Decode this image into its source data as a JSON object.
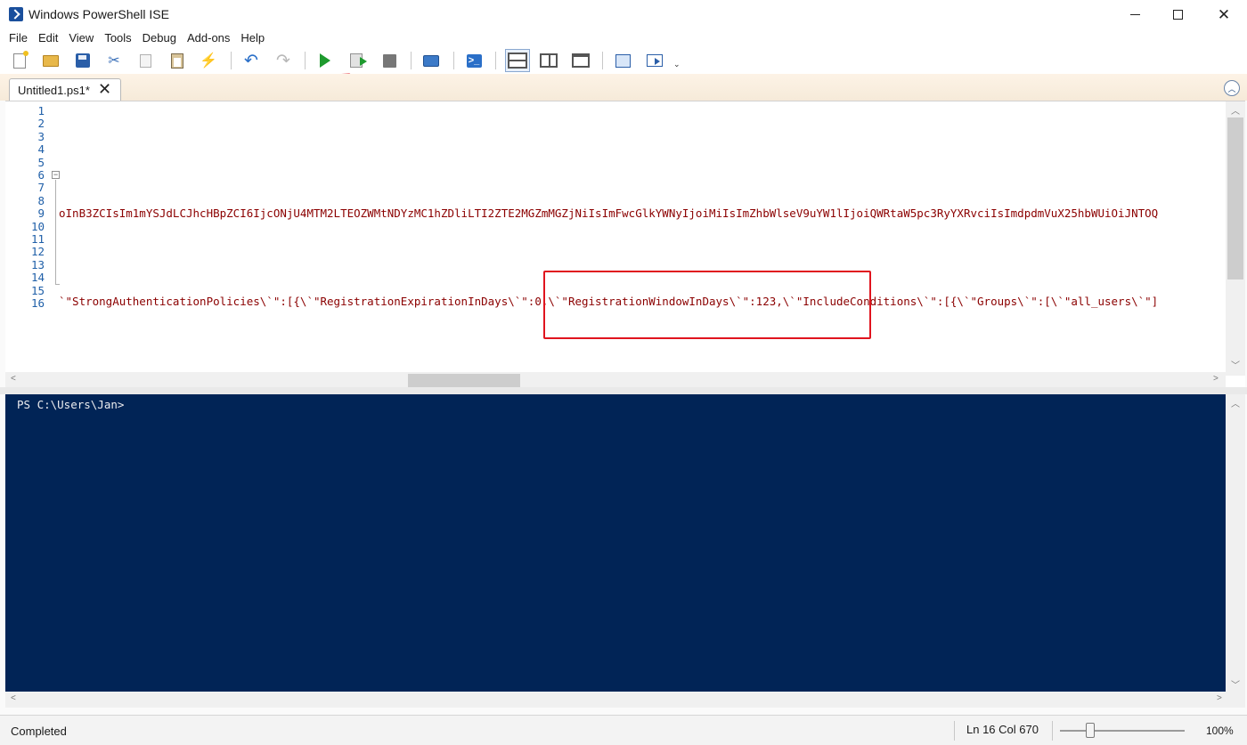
{
  "window": {
    "title": "Windows PowerShell ISE",
    "icon": "powershell-icon",
    "controls": {
      "minimize": "minimize",
      "maximize": "maximize",
      "close": "✕"
    }
  },
  "menu": [
    "File",
    "Edit",
    "View",
    "Tools",
    "Debug",
    "Add-ons",
    "Help"
  ],
  "toolbar": {
    "buttons": [
      "new-script",
      "open",
      "save",
      "cut",
      "copy",
      "paste",
      "clear-console",
      "undo",
      "redo",
      "run-script",
      "run-selection",
      "stop",
      "new-remote-tab",
      "start-powershell",
      "show-script-top",
      "show-script-right",
      "show-script-maximized",
      "show-command-window",
      "show-command-addon"
    ],
    "overflow": "⌄"
  },
  "tabs": [
    {
      "label": "Untitled1.ps1*",
      "close": "✕"
    }
  ],
  "editor": {
    "line_numbers": [
      "1",
      "2",
      "3",
      "4",
      "5",
      "6",
      "7",
      "8",
      "9",
      "10",
      "11",
      "12",
      "13",
      "14",
      "15",
      "16"
    ],
    "fold_marker": "−",
    "line9": "oInB3ZCIsIm1mYSJdLCJhcHBpZCI6IjcONjU4MTM2LTEOZWMtNDYzMC1hZDliLTI2ZTE2MGZmMGZjNiIsImFwcGlkYWNyIjoiMiIsImZhbWlseV9uYW1lIjoiQWRtaW5pc3RyYXRvciIsImdpdmVuX25hbWUiOiJNTOQ",
    "line16": "`\"StrongAuthenticationPolicies\\`\":[{\\`\"RegistrationExpirationInDays\\`\":0,\\`\"RegistrationWindowInDays\\`\":123,\\`\"IncludeConditions\\`\":[{\\`\"Groups\\`\":[\\`\"all_users\\`\"]"
  },
  "console": {
    "prompt": "PS C:\\Users\\Jan>"
  },
  "statusbar": {
    "status": "Completed",
    "position": "Ln 16  Col 670",
    "zoom": "100%",
    "zoom_level_percent": 100
  },
  "colors": {
    "console_bg": "#012456",
    "code_string": "#8b0000",
    "line_number": "#1f5fa8",
    "annotation": "#e0141e",
    "run_button": "#1e9a2e"
  }
}
